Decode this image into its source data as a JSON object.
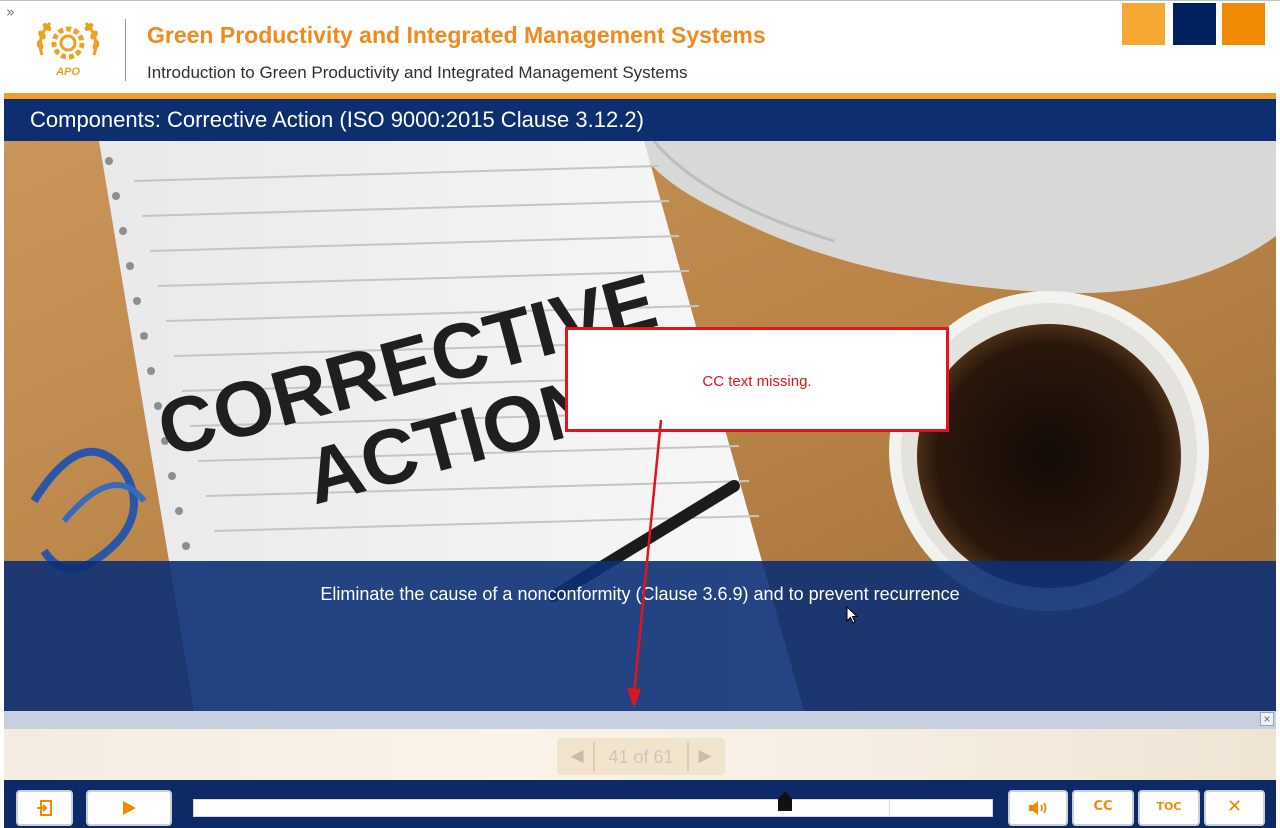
{
  "header": {
    "expand_glyph": "»",
    "logo_text": "APO",
    "title": "Green Productivity and Integrated Management Systems",
    "subtitle": "Introduction to Green Productivity and Integrated Management Systems"
  },
  "slide": {
    "title": "Components: Corrective Action (ISO 9000:2015 Clause 3.12.2)",
    "caption": "Eliminate the cause of a nonconformity (Clause 3.6.9) and to prevent recurrence",
    "image": {
      "notebook_line1": "CORRECTIVE",
      "notebook_line2": "ACTION"
    },
    "annotation_text": "CC text missing."
  },
  "cc_panel": {
    "close_glyph": "×"
  },
  "pager": {
    "prev_glyph": "◀",
    "text": "41 of 61",
    "next_glyph": "▶"
  },
  "controls": {
    "exit_icon": "exit-icon",
    "play_icon": "play-icon",
    "audio_icon": "speaker-icon",
    "cc_label": "CC",
    "toc_label": "TOC",
    "close_label": "✕",
    "progress_fraction": 0.74
  },
  "colors": {
    "brand_orange": "#f08a1c",
    "navy": "#0e2a66",
    "accent_yellow": "#f7a833",
    "annotation_red": "#e3141b"
  }
}
